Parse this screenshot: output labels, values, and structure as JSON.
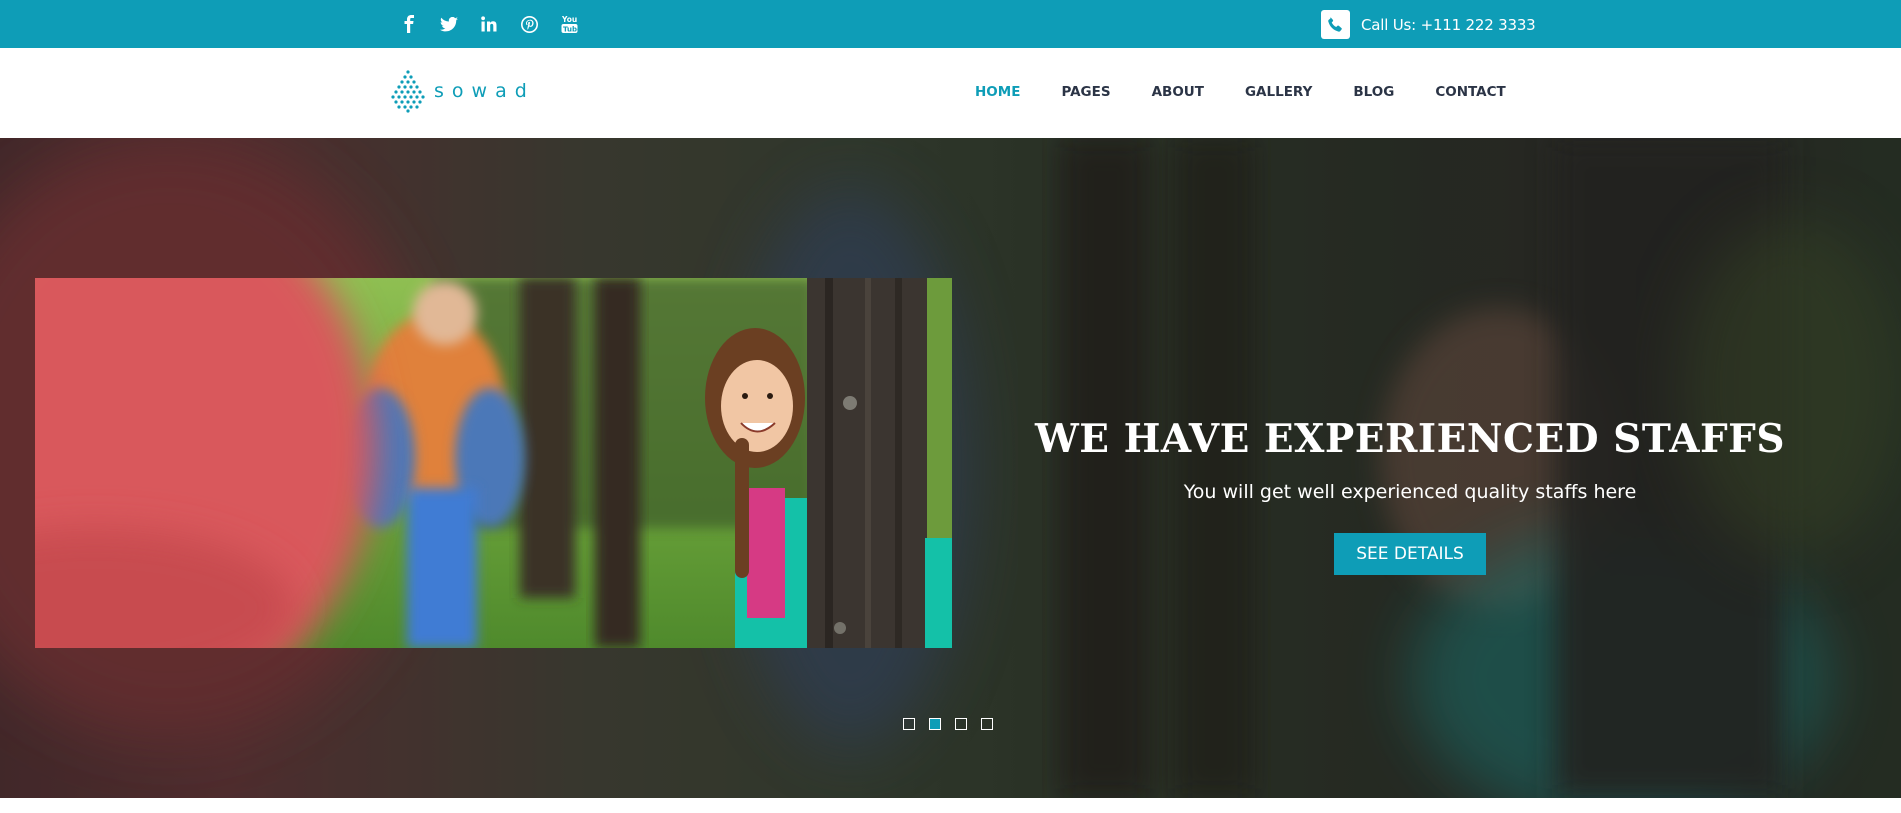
{
  "topbar": {
    "social_icons": [
      "facebook-icon",
      "twitter-icon",
      "linkedin-icon",
      "pinterest-icon",
      "youtube-icon"
    ],
    "phone_icon": "phone-icon",
    "call_text": "Call Us: +111 222 3333"
  },
  "header": {
    "logo_text": "sowad",
    "nav": [
      "HOME",
      "PAGES",
      "ABOUT",
      "GALLERY",
      "BLOG",
      "CONTACT"
    ],
    "active_nav": "HOME"
  },
  "hero": {
    "headline": "WE HAVE EXPERIENCED STAFFS",
    "subheadline": "You will get well experienced quality staffs here",
    "cta_label": "SEE DETAILS",
    "slide_count": 4,
    "active_slide": 2
  },
  "colors": {
    "accent": "#0e9db7",
    "nav_text": "#2b3446",
    "white": "#ffffff"
  }
}
